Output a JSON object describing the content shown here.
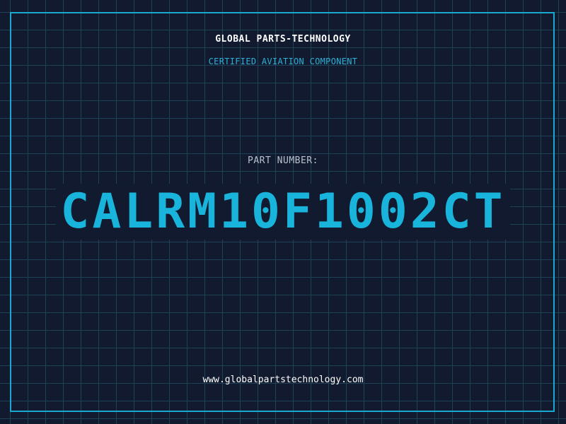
{
  "header": {
    "company": "GLOBAL PARTS-TECHNOLOGY",
    "tagline": "CERTIFIED AVIATION COMPONENT"
  },
  "part": {
    "label": "PART NUMBER:",
    "number": "CALRM10F1002CT"
  },
  "footer": {
    "website": "www.globalpartstechnology.com"
  },
  "colors": {
    "background": "#111a2e",
    "grid": "#1f4356",
    "accent": "#18b4dc",
    "text": "#ffffff"
  }
}
